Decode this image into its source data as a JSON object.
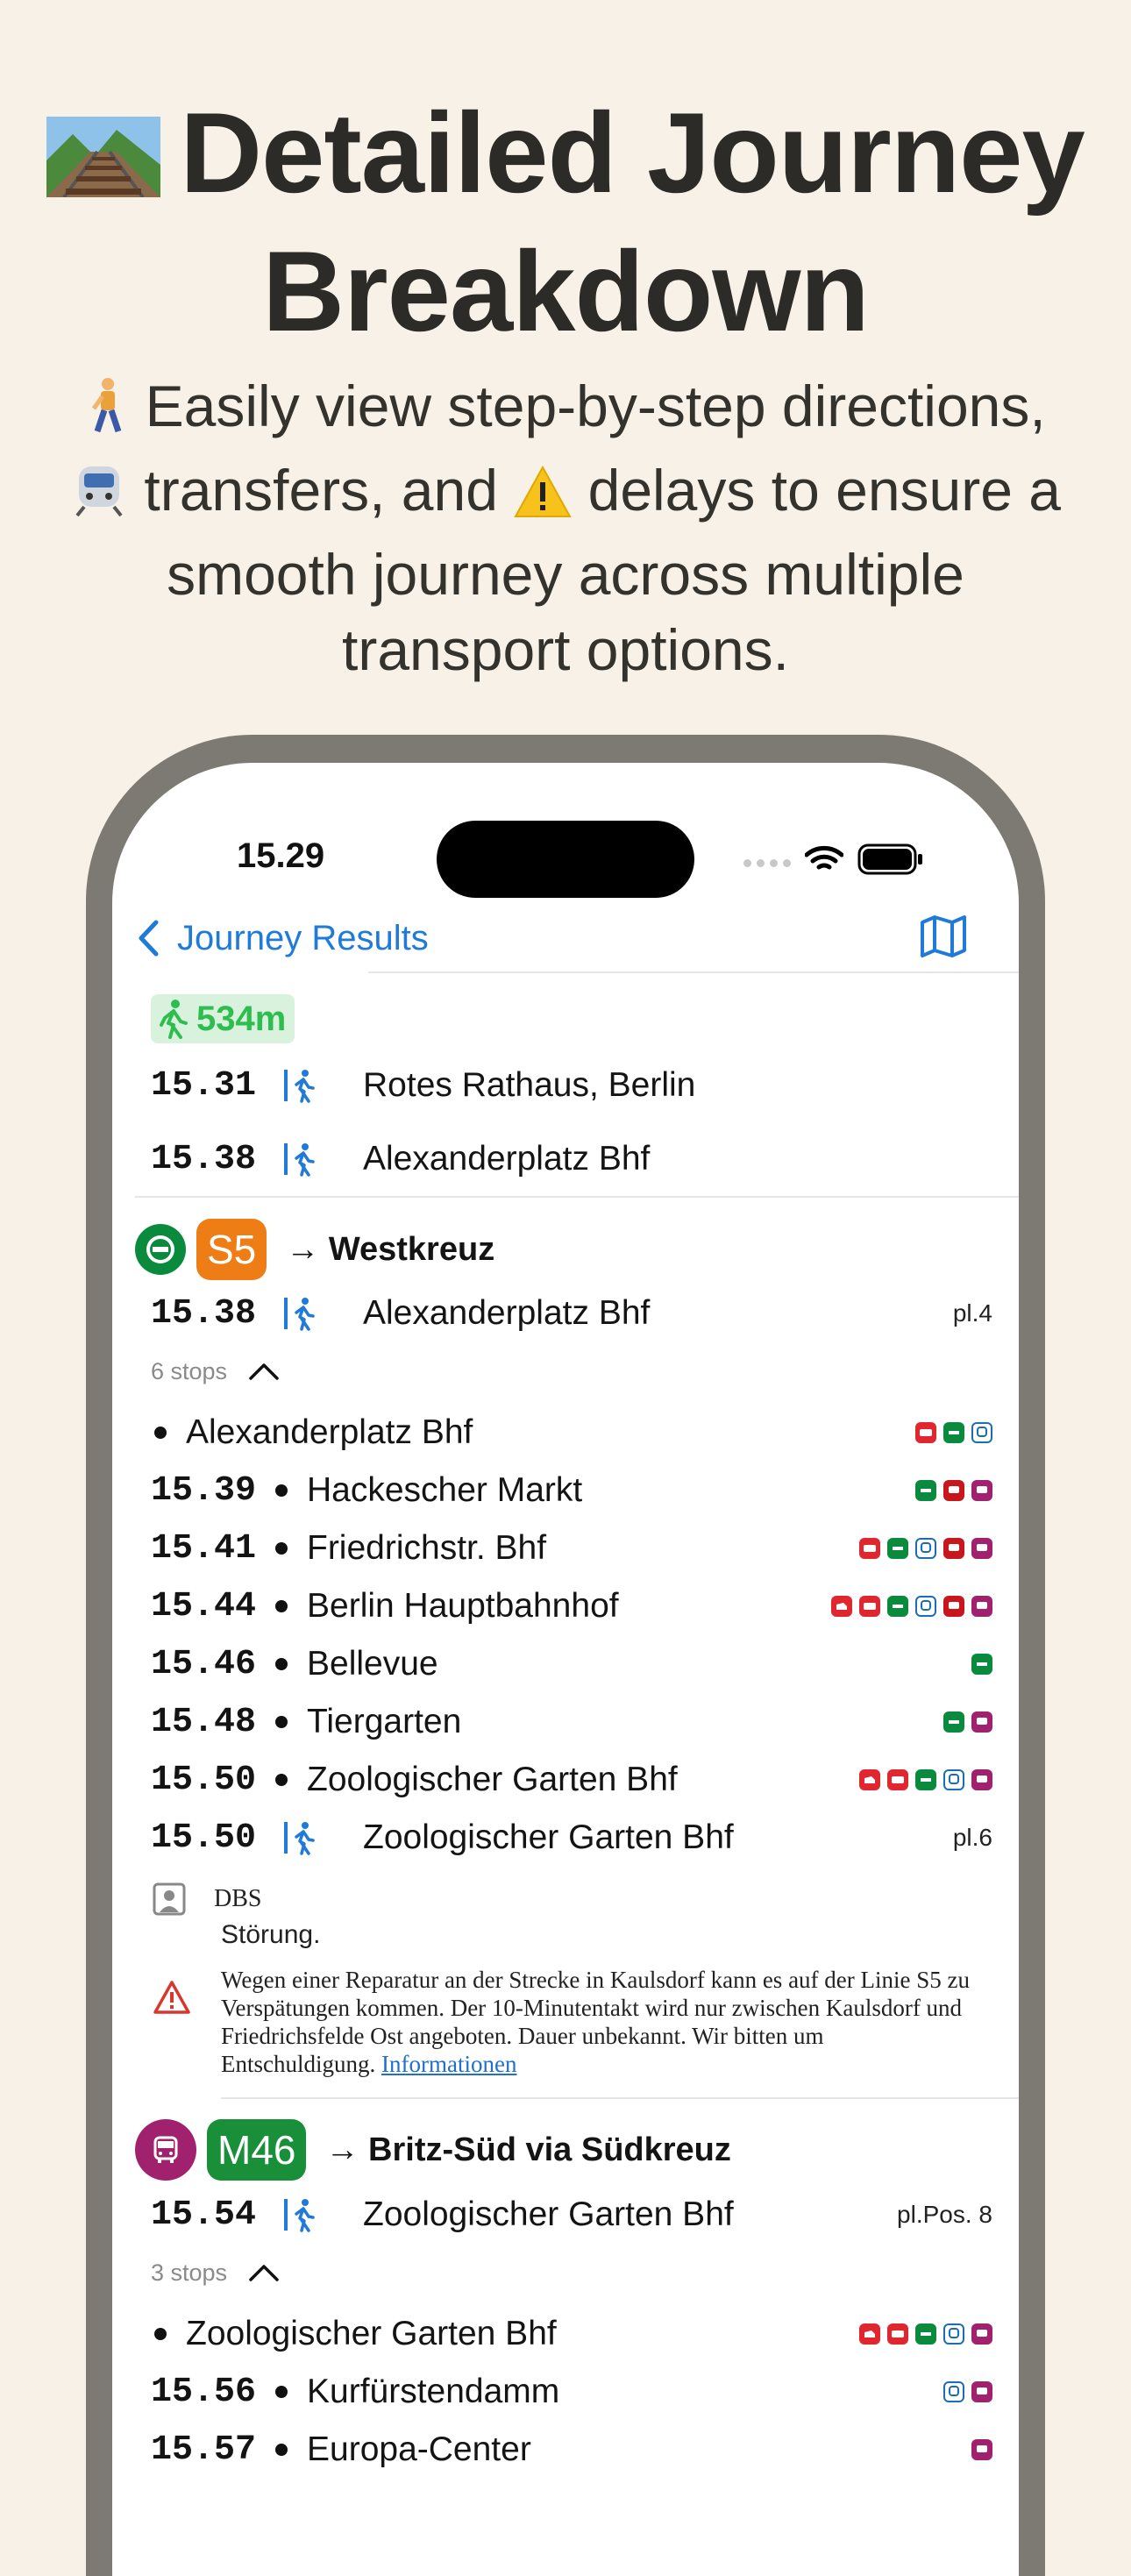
{
  "hero": {
    "title": "Detailed Journey Breakdown",
    "subtitle_parts": [
      "Easily view step-by-step directions,",
      "transfers, and",
      "delays to ensure a smooth journey across multiple transport options."
    ]
  },
  "status_bar": {
    "time": "15.29"
  },
  "nav": {
    "back_label": "Journey Results"
  },
  "walk_leg": {
    "distance": "534m",
    "from": {
      "time": "15.31",
      "station": "Rotes Rathaus, Berlin"
    },
    "to": {
      "time": "15.38",
      "station": "Alexanderplatz Bhf"
    }
  },
  "leg_s5": {
    "line": "S5",
    "line_color": "#ef7d16",
    "mode_color": "#0a8a3c",
    "destination": "→ Westkreuz",
    "departure": {
      "time": "15.38",
      "station": "Alexanderplatz Bhf",
      "platform": "pl.4"
    },
    "stops_label": "6 stops",
    "stops": [
      {
        "time": "",
        "name": "Alexanderplatz Bhf"
      },
      {
        "time": "15.39",
        "name": "Hackescher Markt"
      },
      {
        "time": "15.41",
        "name": "Friedrichstr. Bhf"
      },
      {
        "time": "15.44",
        "name": "Berlin Hauptbahnhof"
      },
      {
        "time": "15.46",
        "name": "Bellevue"
      },
      {
        "time": "15.48",
        "name": "Tiergarten"
      },
      {
        "time": "15.50",
        "name": "Zoologischer Garten Bhf"
      }
    ],
    "arrival": {
      "time": "15.50",
      "station": "Zoologischer Garten Bhf",
      "platform": "pl.6"
    },
    "notice": {
      "source": "DBS",
      "title": "Störung.",
      "body": "Wegen einer Reparatur an der Strecke in Kaulsdorf kann es auf der Linie S5 zu Verspätungen kommen. Der 10-Minutentakt wird nur zwischen Kaulsdorf und Friedrichsfelde Ost angeboten. Dauer unbekannt. Wir bitten um Entschuldigung.",
      "link": "Informationen"
    }
  },
  "leg_m46": {
    "line": "M46",
    "line_color": "#1a8f3a",
    "mode_color": "#a0226e",
    "destination": "→ Britz-Süd via Südkreuz",
    "departure": {
      "time": "15.54",
      "station": "Zoologischer Garten Bhf",
      "platform": "pl.Pos. 8"
    },
    "stops_label": "3 stops",
    "stops": [
      {
        "time": "",
        "name": "Zoologischer Garten Bhf"
      },
      {
        "time": "15.56",
        "name": "Kurfürstendamm"
      },
      {
        "time": "15.57",
        "name": "Europa-Center"
      }
    ]
  },
  "colors": {
    "accent": "#1f7ad8",
    "walk_green": "#2ebd4e",
    "regional_red": "#e0262f",
    "sbahn_green": "#0a8a3c",
    "ubahn_blue": "#1a6fb3",
    "tram_red": "#c8161d",
    "bus_purple": "#a0226e"
  }
}
